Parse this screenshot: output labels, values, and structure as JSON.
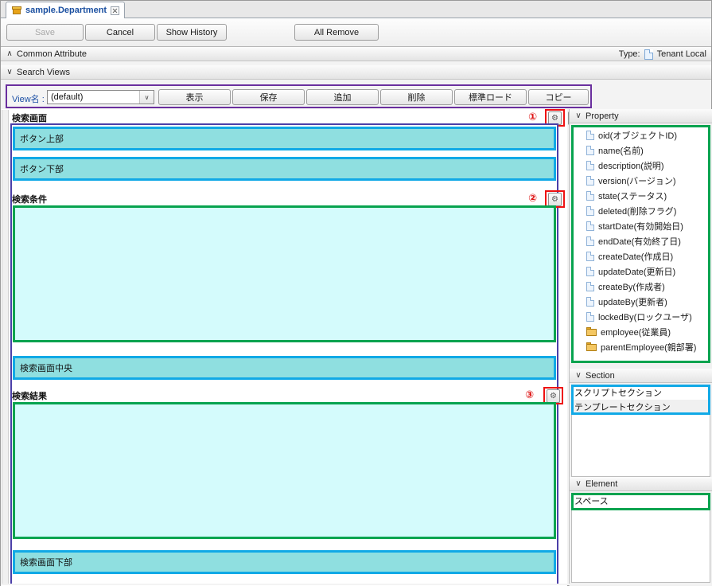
{
  "tab": {
    "title": "sample.Department",
    "icon": "package-box-icon",
    "close_icon": "close-icon"
  },
  "toolbar": {
    "save": "Save",
    "cancel": "Cancel",
    "show_history": "Show History",
    "all_remove": "All Remove"
  },
  "common_attribute": {
    "label": "Common Attribute",
    "chevron": "∧",
    "type_label": "Type:",
    "type_value": "Tenant Local"
  },
  "search_views": {
    "label": "Search Views",
    "chevron": "∨"
  },
  "viewbar": {
    "label": "View名 :",
    "combo_value": "(default)",
    "combo_arrow": "∨",
    "buttons": [
      {
        "label": "表示"
      },
      {
        "label": "保存"
      },
      {
        "label": "追加"
      },
      {
        "label": "削除"
      },
      {
        "label": "標準ロード"
      },
      {
        "label": "コピー"
      }
    ]
  },
  "canvas": {
    "groups": [
      {
        "name": "search-screen",
        "label": "検索画面",
        "marker": "①",
        "gear": "gear-icon"
      },
      {
        "name": "search-condition",
        "label": "検索条件",
        "marker": "②",
        "gear": "gear-icon"
      },
      {
        "name": "search-result",
        "label": "検索結果",
        "marker": "③",
        "gear": "gear-icon"
      }
    ],
    "panels": {
      "button_top": "ボタン上部",
      "button_bottom": "ボタン下部",
      "screen_center": "検索画面中央",
      "screen_bottom": "検索画面下部"
    },
    "chevron_button": "∨"
  },
  "dock": {
    "property": {
      "label": "Property",
      "chevron": "∨",
      "items": [
        {
          "icon": "file-icon",
          "label": "oid(オブジェクトID)"
        },
        {
          "icon": "file-icon",
          "label": "name(名前)"
        },
        {
          "icon": "file-icon",
          "label": "description(説明)"
        },
        {
          "icon": "file-icon",
          "label": "version(バージョン)"
        },
        {
          "icon": "file-icon",
          "label": "state(ステータス)"
        },
        {
          "icon": "file-icon",
          "label": "deleted(削除フラグ)"
        },
        {
          "icon": "file-icon",
          "label": "startDate(有効開始日)"
        },
        {
          "icon": "file-icon",
          "label": "endDate(有効終了日)"
        },
        {
          "icon": "file-icon",
          "label": "createDate(作成日)"
        },
        {
          "icon": "file-icon",
          "label": "updateDate(更新日)"
        },
        {
          "icon": "file-icon",
          "label": "createBy(作成者)"
        },
        {
          "icon": "file-icon",
          "label": "updateBy(更新者)"
        },
        {
          "icon": "file-icon",
          "label": "lockedBy(ロックユーザ)"
        },
        {
          "icon": "folder-icon",
          "label": "employee(従業員)"
        },
        {
          "icon": "folder-icon",
          "label": "parentEmployee(親部署)"
        }
      ]
    },
    "section": {
      "label": "Section",
      "chevron": "∨",
      "items": [
        {
          "label": "スクリプトセクション"
        },
        {
          "label": "テンプレートセクション"
        }
      ]
    },
    "element": {
      "label": "Element",
      "chevron": "∨",
      "items": [
        {
          "label": "スペース"
        }
      ]
    }
  },
  "colors": {
    "accent_blue": "#11a9e6",
    "accent_green": "#07a34f",
    "accent_purple": "#6a2f9e",
    "marker_red": "#ee1111",
    "panel_cyan": "#8fdfe0",
    "area_cyan": "#d4fbfc",
    "tab_title": "#1a4fa0"
  }
}
